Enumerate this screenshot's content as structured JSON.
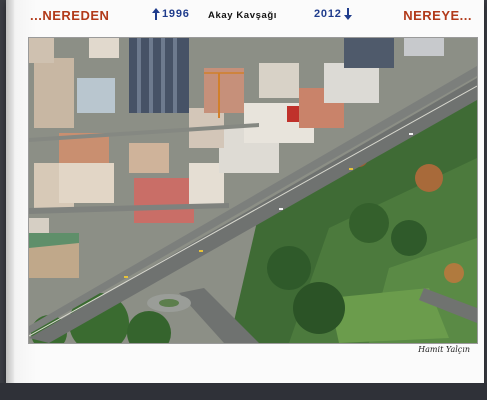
{
  "header": {
    "left_title": "...NEREDEN",
    "right_title": "NEREYE...",
    "year_left": "1996",
    "year_right": "2012",
    "center_title": "Akay Kavşağı",
    "accent_red": "#b23a1a",
    "accent_blue": "#1f3c8c",
    "arrow_left_icon": "arrow-up-icon",
    "arrow_right_icon": "arrow-down-icon"
  },
  "photo": {
    "subject": "aerial-city-photo"
  },
  "signature": {
    "text": "Hamit Yalçın"
  }
}
